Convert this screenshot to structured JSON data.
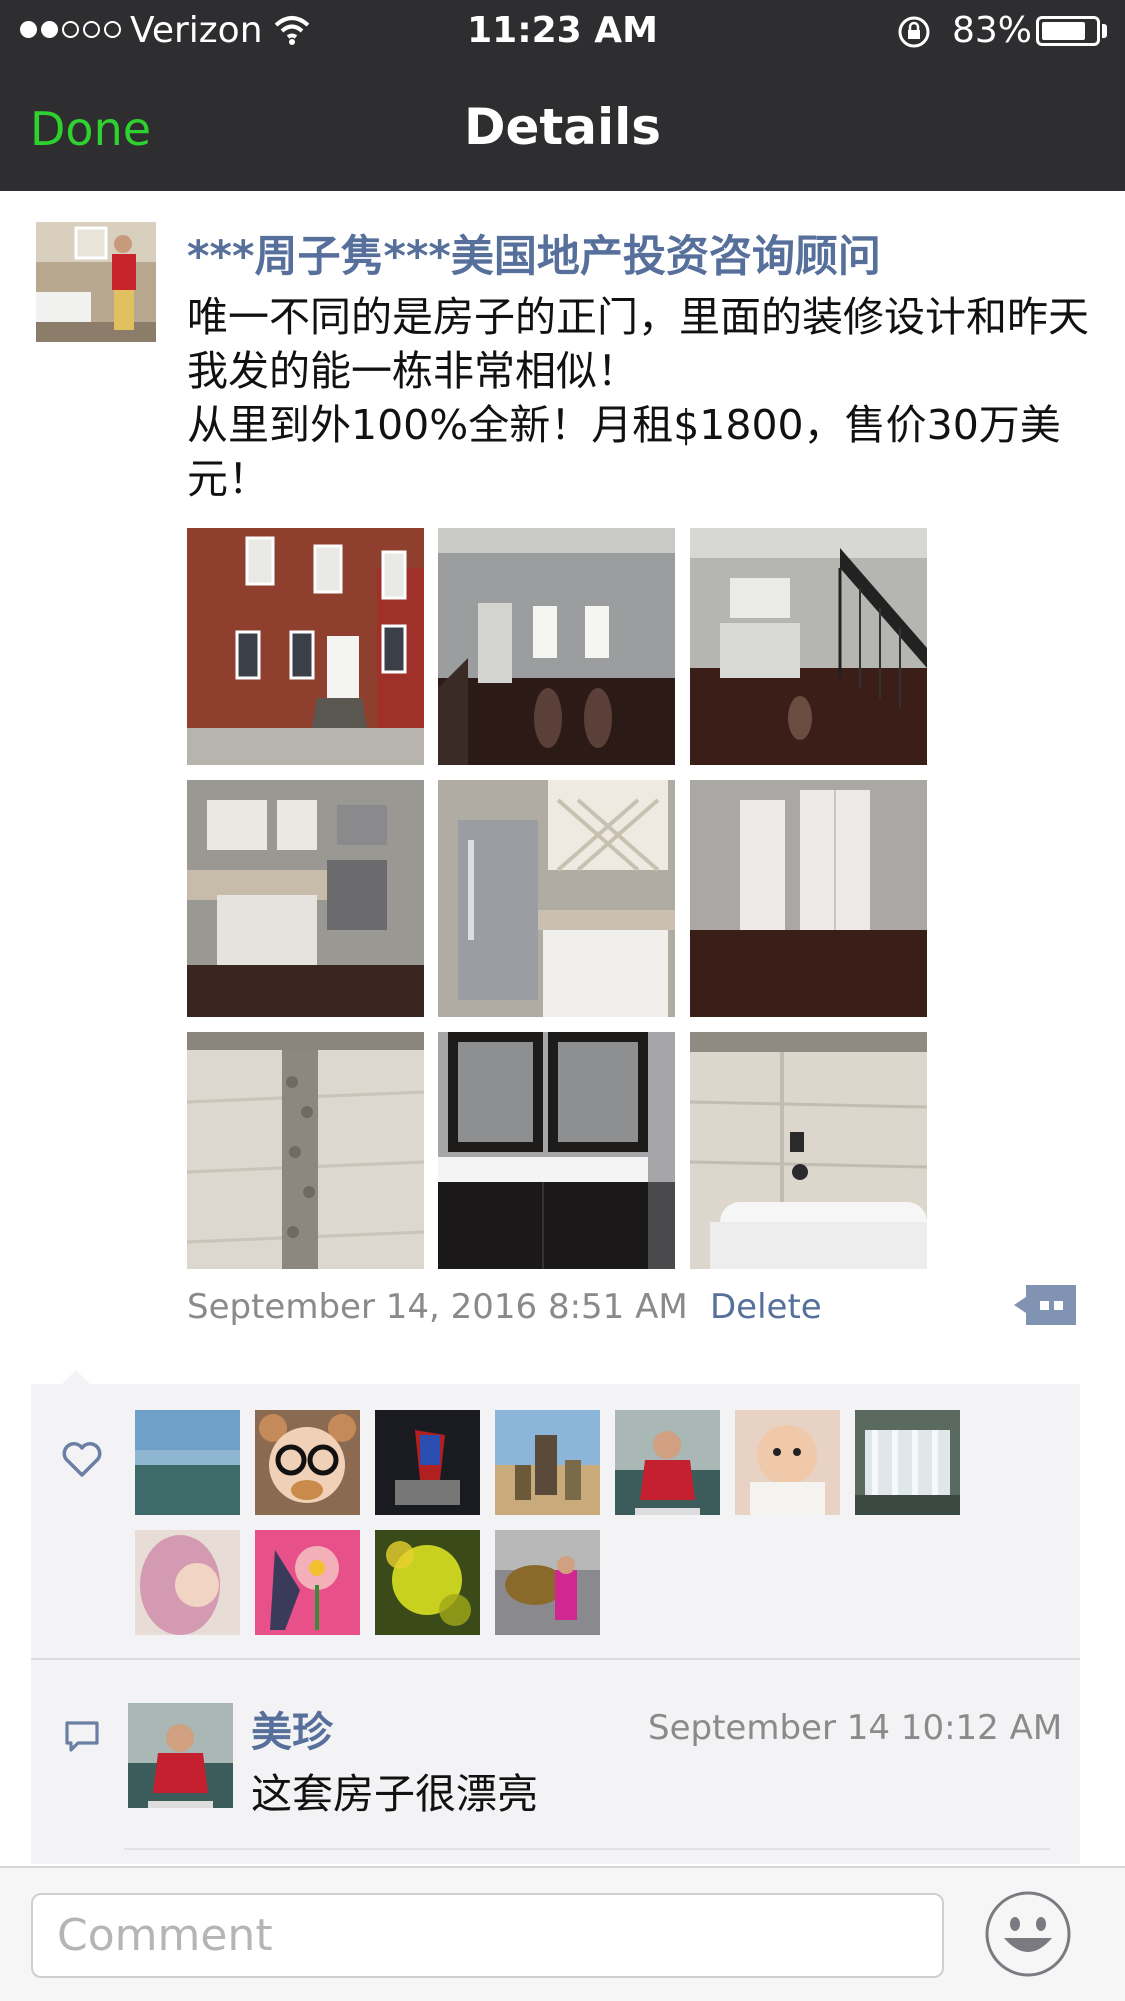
{
  "status_bar": {
    "carrier": "Verizon",
    "time": "11:23 AM",
    "battery": "83%",
    "battery_level": 0.83,
    "signal_bars_filled": 2,
    "signal_bars_total": 5
  },
  "nav": {
    "done_label": "Done",
    "title": "Details"
  },
  "post": {
    "author": "***周子隽***美国地产投资咨询顾问",
    "text": "唯一不同的是房子的正门，里面的装修设计和昨天我发的能一栋非常相似！\n从里到外100%全新！月租$1800，售价30万美元！",
    "photos": [
      "brick-rowhouse-exterior",
      "living-room-windows",
      "open-floor-staircase",
      "kitchen-stove",
      "kitchen-fridge-wine-rack",
      "bedroom-closet-doors",
      "tiled-shower-wall",
      "double-vanity-bathroom",
      "bathtub-tile"
    ],
    "timestamp": "September 14, 2016 8:51 AM",
    "delete_label": "Delete"
  },
  "likes": {
    "avatars": [
      "landscape-sky",
      "bear-ears-child",
      "superhero-figurine",
      "desert-people",
      "woman-waving",
      "baby",
      "waterfall",
      "pink-hair-portrait",
      "flower-art",
      "yellow-bokeh-art",
      "woman-with-bull"
    ]
  },
  "comments": [
    {
      "name": "美珍",
      "time": "September 14 10:12 AM",
      "text": "这套房子很漂亮"
    }
  ],
  "comment_bar": {
    "placeholder": "Comment"
  },
  "colors": {
    "nav_bg": "#2e2e30",
    "done_green": "#2fd12f",
    "link_blue": "#56709b",
    "panel_bg": "#f3f3f5"
  }
}
